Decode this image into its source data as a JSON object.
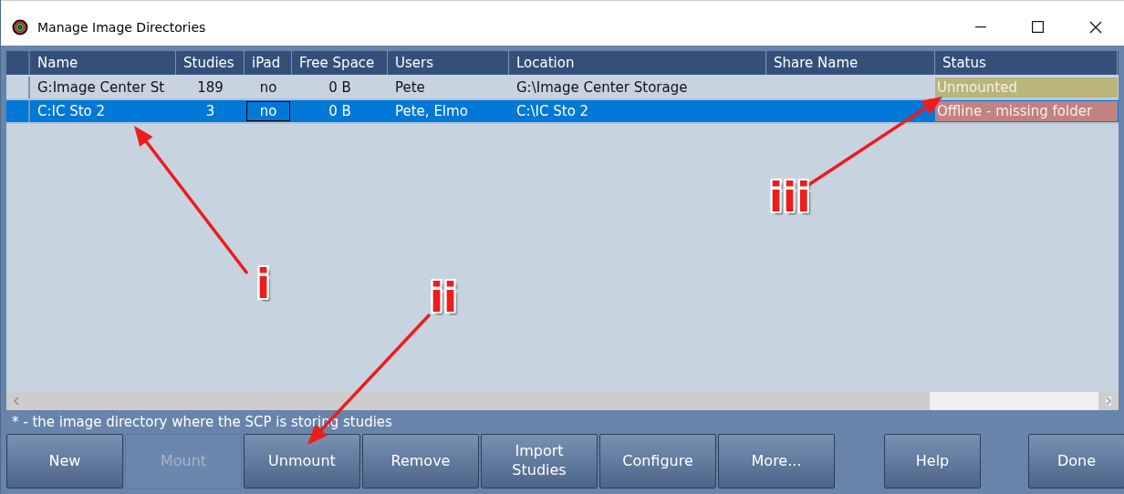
{
  "window": {
    "title": "Manage Image Directories"
  },
  "table": {
    "columns": [
      "Name",
      "Studies",
      "iPad",
      "Free Space",
      "Users",
      "Location",
      "Share Name",
      "Status"
    ],
    "rows": [
      {
        "selected": false,
        "ipad_focused": false,
        "cells": [
          "G:Image Center St",
          "189",
          "no",
          "0 B",
          "Pete",
          "G:\\Image Center Storage",
          ""
        ],
        "status": {
          "text": "Unmounted",
          "color": "#b9b57b"
        }
      },
      {
        "selected": true,
        "ipad_focused": true,
        "cells": [
          "C:IC Sto 2",
          "3",
          "no",
          "0 B",
          "Pete, Elmo",
          "C:\\IC Sto 2",
          ""
        ],
        "status": {
          "text": "Offline - missing folder",
          "color": "#c08282"
        }
      }
    ]
  },
  "footnote": "* - the image directory where the SCP is storing studies",
  "buttons": [
    {
      "label": "New",
      "disabled": false
    },
    {
      "label": "Mount",
      "disabled": true
    },
    {
      "label": "Unmount",
      "disabled": false
    },
    {
      "label": "Remove",
      "disabled": false
    },
    {
      "label": "Import Studies",
      "disabled": false
    },
    {
      "label": "Configure",
      "disabled": false
    },
    {
      "label": "More...",
      "disabled": false
    }
  ],
  "right_buttons": [
    {
      "label": "Help",
      "disabled": false
    },
    {
      "label": "Done",
      "disabled": false
    }
  ],
  "callouts": [
    "i",
    "ii",
    "iii"
  ]
}
